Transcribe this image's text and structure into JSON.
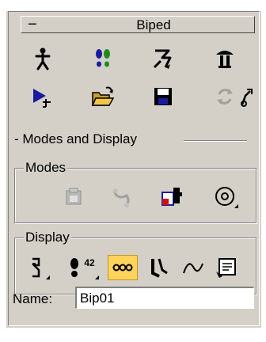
{
  "rollout": {
    "collapse_symbol": "−",
    "title": "Biped"
  },
  "toolbar_row1": [
    {
      "icon": "figure-mode-icon"
    },
    {
      "icon": "footstep-mode-icon"
    },
    {
      "icon": "motion-flow-mode-icon"
    },
    {
      "icon": "mixer-mode-icon"
    }
  ],
  "toolbar_row2": [
    {
      "icon": "biped-playback-icon"
    },
    {
      "icon": "load-file-icon"
    },
    {
      "icon": "save-file-icon"
    },
    {
      "icon": "convert-icon",
      "disabled": true
    },
    {
      "icon": "move-all-mode-icon"
    }
  ],
  "modes_and_display": {
    "title": "- Modes and Display"
  },
  "modes_group": {
    "label": "Modes",
    "buttons": [
      {
        "icon": "buffer-mode-icon",
        "disabled": true
      },
      {
        "icon": "rubber-band-mode-icon",
        "disabled": true
      },
      {
        "icon": "scale-stride-icon"
      },
      {
        "icon": "in-place-mode-icon"
      }
    ]
  },
  "display_group": {
    "label": "Display",
    "buttons": [
      {
        "icon": "display-objects-icon",
        "flyout": true
      },
      {
        "icon": "display-footsteps-icon",
        "badge": "42",
        "flyout": true
      },
      {
        "icon": "twist-links-icon",
        "active": true
      },
      {
        "icon": "show-legs-icon"
      },
      {
        "icon": "display-trajectories-icon"
      },
      {
        "icon": "biped-preferences-icon"
      }
    ]
  },
  "name_field": {
    "label": "Name:",
    "value": "Bip01"
  },
  "colors": {
    "panel_bg": "#d4d0c8",
    "active_button": "#ffd35c",
    "icon_blue": "#1a1aa0",
    "icon_green": "#1f8a1f"
  }
}
